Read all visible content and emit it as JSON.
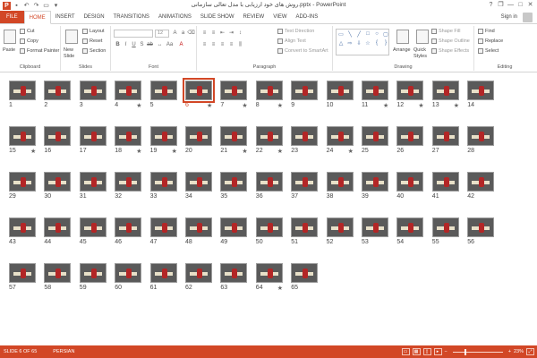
{
  "titlebar": {
    "logo": "P",
    "title": "روش های خود ارزیابی با مدل تعالی سازمانی.pptx - PowerPoint",
    "help": "?",
    "restore": "❐",
    "minimize": "—",
    "maximize": "□",
    "close": "✕"
  },
  "tabs": {
    "items": [
      "FILE",
      "HOME",
      "INSERT",
      "DESIGN",
      "TRANSITIONS",
      "ANIMATIONS",
      "SLIDE SHOW",
      "REVIEW",
      "VIEW",
      "ADD-INS"
    ],
    "active": "HOME",
    "sign_in": "Sign in"
  },
  "ribbon": {
    "clipboard": {
      "label": "Clipboard",
      "paste": "Paste",
      "cut": "Cut",
      "copy": "Copy",
      "format_painter": "Format Painter"
    },
    "slides": {
      "label": "Slides",
      "new_slide": "New Slide",
      "layout": "Layout",
      "reset": "Reset",
      "section": "Section"
    },
    "font": {
      "label": "Font",
      "size": "12"
    },
    "paragraph": {
      "label": "Paragraph",
      "text_direction": "Text Direction",
      "align_text": "Align Text",
      "convert_smartart": "Convert to SmartArt"
    },
    "drawing": {
      "label": "Drawing",
      "arrange": "Arrange",
      "quick_styles": "Quick Styles",
      "shape_fill": "Shape Fill",
      "shape_outline": "Shape Outline",
      "shape_effects": "Shape Effects"
    },
    "editing": {
      "label": "Editing",
      "find": "Find",
      "replace": "Replace",
      "select": "Select"
    }
  },
  "sorter": {
    "selected_slide": 6,
    "slides": [
      {
        "n": "1",
        "star": false
      },
      {
        "n": "2",
        "star": false
      },
      {
        "n": "3",
        "star": false
      },
      {
        "n": "4",
        "star": true
      },
      {
        "n": "5",
        "star": false
      },
      {
        "n": "6",
        "star": true
      },
      {
        "n": "7",
        "star": true
      },
      {
        "n": "8",
        "star": true
      },
      {
        "n": "9",
        "star": false
      },
      {
        "n": "10",
        "star": false
      },
      {
        "n": "11",
        "star": true
      },
      {
        "n": "12",
        "star": true
      },
      {
        "n": "13",
        "star": true
      },
      {
        "n": "14",
        "star": false
      },
      {
        "n": "15",
        "star": true
      },
      {
        "n": "16",
        "star": false
      },
      {
        "n": "17",
        "star": false
      },
      {
        "n": "18",
        "star": true
      },
      {
        "n": "19",
        "star": true
      },
      {
        "n": "20",
        "star": false
      },
      {
        "n": "21",
        "star": true
      },
      {
        "n": "22",
        "star": true
      },
      {
        "n": "23",
        "star": false
      },
      {
        "n": "24",
        "star": true
      },
      {
        "n": "25",
        "star": false
      },
      {
        "n": "26",
        "star": false
      },
      {
        "n": "27",
        "star": false
      },
      {
        "n": "28",
        "star": false
      },
      {
        "n": "29",
        "star": false
      },
      {
        "n": "30",
        "star": false
      },
      {
        "n": "31",
        "star": false
      },
      {
        "n": "32",
        "star": false
      },
      {
        "n": "33",
        "star": false
      },
      {
        "n": "34",
        "star": false
      },
      {
        "n": "35",
        "star": false
      },
      {
        "n": "36",
        "star": false
      },
      {
        "n": "37",
        "star": false
      },
      {
        "n": "38",
        "star": false
      },
      {
        "n": "39",
        "star": false
      },
      {
        "n": "40",
        "star": false
      },
      {
        "n": "41",
        "star": false
      },
      {
        "n": "42",
        "star": false
      },
      {
        "n": "43",
        "star": false
      },
      {
        "n": "44",
        "star": false
      },
      {
        "n": "45",
        "star": false
      },
      {
        "n": "46",
        "star": false
      },
      {
        "n": "47",
        "star": false
      },
      {
        "n": "48",
        "star": false
      },
      {
        "n": "49",
        "star": false
      },
      {
        "n": "50",
        "star": false
      },
      {
        "n": "51",
        "star": false
      },
      {
        "n": "52",
        "star": false
      },
      {
        "n": "53",
        "star": false
      },
      {
        "n": "54",
        "star": false
      },
      {
        "n": "55",
        "star": false
      },
      {
        "n": "56",
        "star": false
      },
      {
        "n": "57",
        "star": false
      },
      {
        "n": "58",
        "star": false
      },
      {
        "n": "59",
        "star": false
      },
      {
        "n": "60",
        "star": false
      },
      {
        "n": "61",
        "star": false
      },
      {
        "n": "62",
        "star": false
      },
      {
        "n": "63",
        "star": false
      },
      {
        "n": "64",
        "star": true
      },
      {
        "n": "65",
        "star": false
      }
    ],
    "star_glyph": "★"
  },
  "statusbar": {
    "slide_of": "SLIDE 6 OF 65",
    "language": "PERSIAN",
    "zoom": "23%",
    "zoom_level": 0.23
  },
  "colors": {
    "accent": "#d24726",
    "slide_bg": "#5a5a5a"
  }
}
